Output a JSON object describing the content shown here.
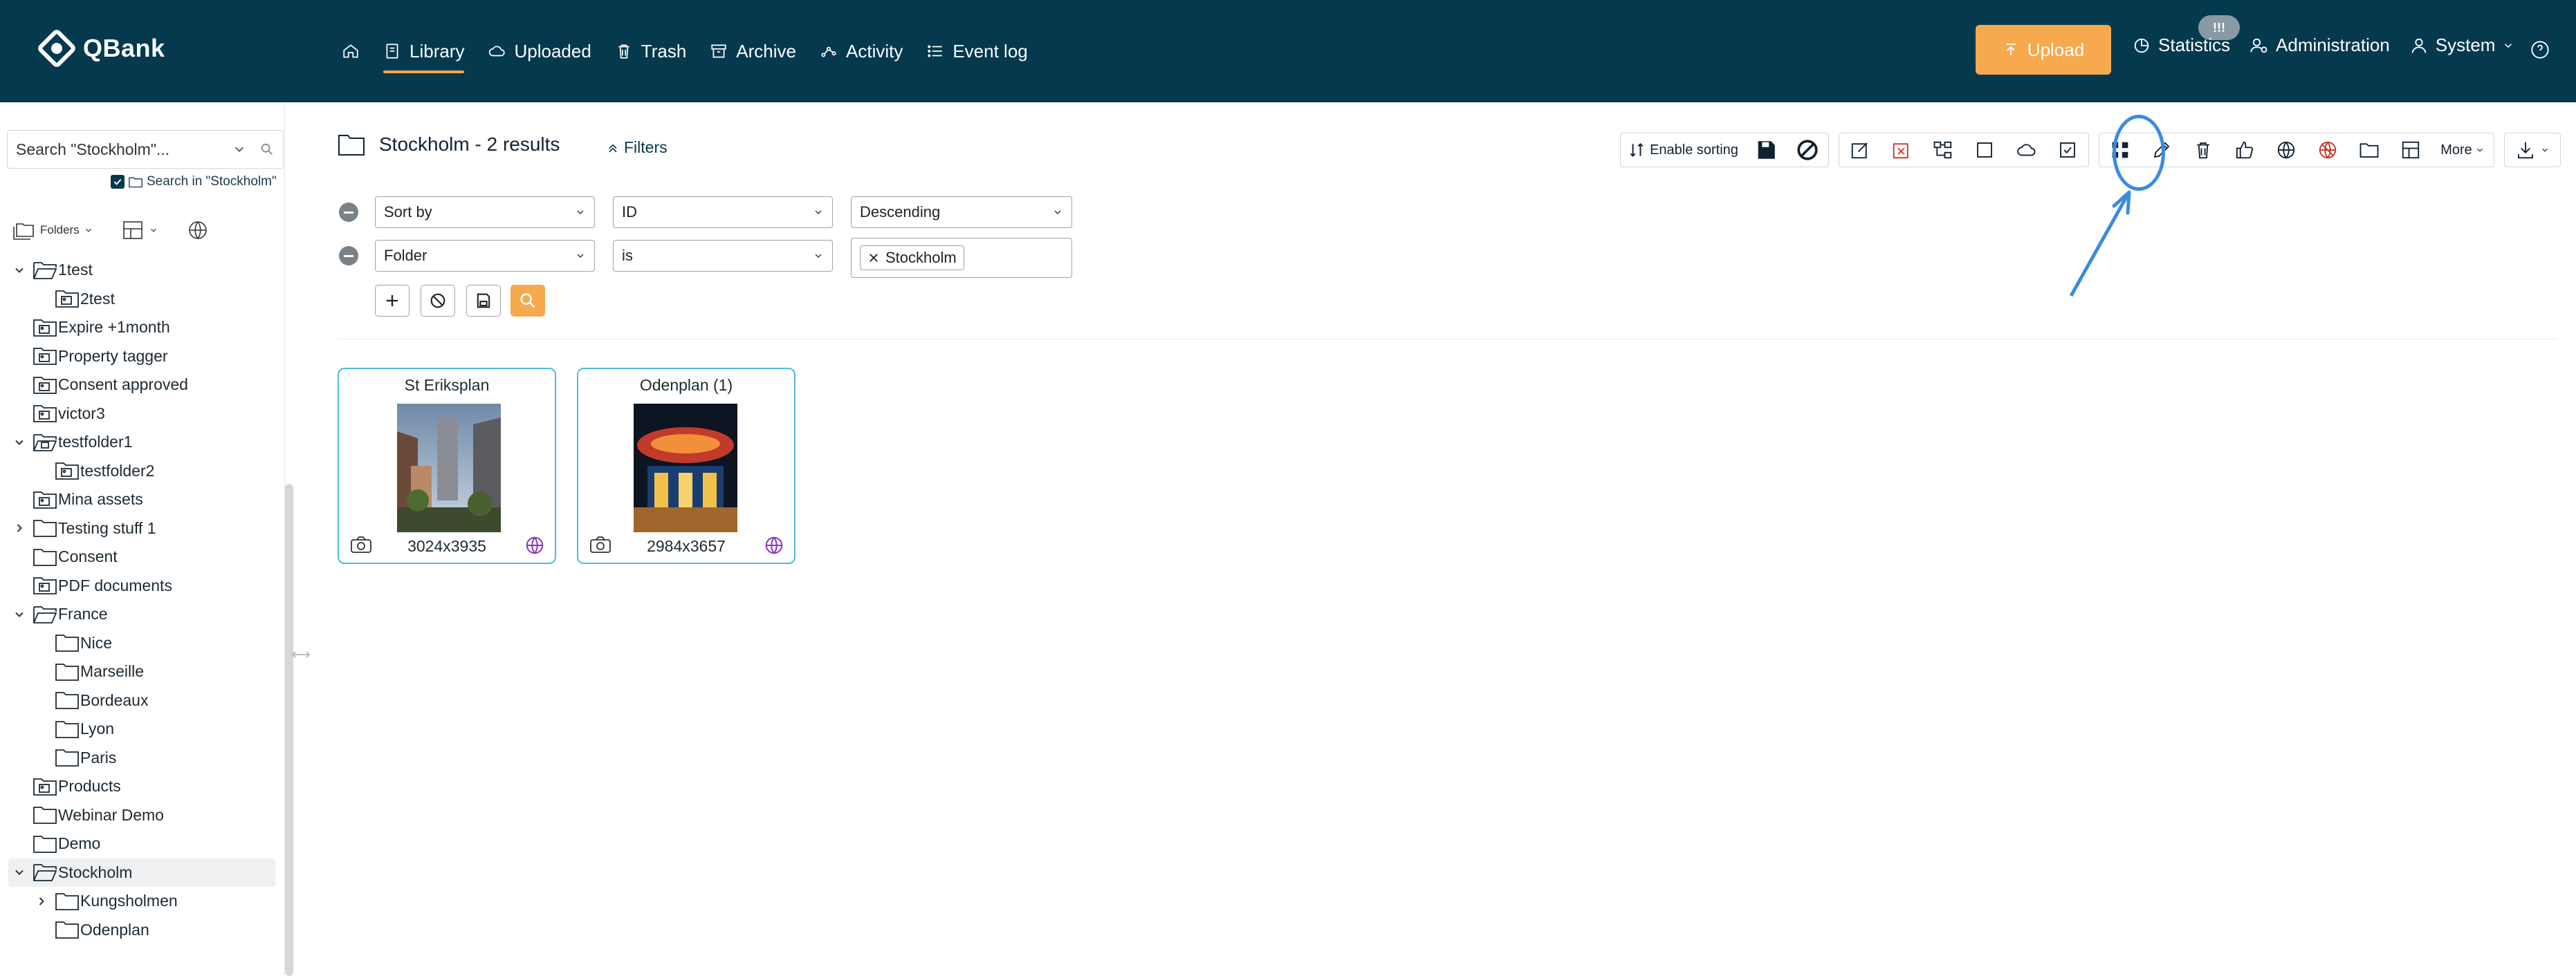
{
  "app": {
    "name": "QBank"
  },
  "nav": {
    "home_label": "",
    "items": [
      {
        "label": "Library"
      },
      {
        "label": "Uploaded"
      },
      {
        "label": "Trash"
      },
      {
        "label": "Archive"
      },
      {
        "label": "Activity"
      },
      {
        "label": "Event log"
      }
    ]
  },
  "topright": {
    "upload_label": "Upload",
    "statistics_label": "Statistics",
    "administration_label": "Administration",
    "system_label": "System",
    "badge": "!!!"
  },
  "sidebar": {
    "search_value": "Search \"Stockholm\"...",
    "search_in_label": "Search in \"Stockholm\"",
    "folders_label": "Folders",
    "tree": [
      {
        "label": "1test"
      },
      {
        "label": "2test"
      },
      {
        "label": "Expire +1month"
      },
      {
        "label": "Property tagger"
      },
      {
        "label": "Consent approved"
      },
      {
        "label": "victor3"
      },
      {
        "label": "testfolder1"
      },
      {
        "label": "testfolder2"
      },
      {
        "label": "Mina assets"
      },
      {
        "label": "Testing stuff 1"
      },
      {
        "label": "Consent"
      },
      {
        "label": "PDF documents"
      },
      {
        "label": "France"
      },
      {
        "label": "Nice"
      },
      {
        "label": "Marseille"
      },
      {
        "label": "Bordeaux"
      },
      {
        "label": "Lyon"
      },
      {
        "label": "Paris"
      },
      {
        "label": "Products"
      },
      {
        "label": "Webinar Demo"
      },
      {
        "label": "Demo"
      },
      {
        "label": "Stockholm"
      },
      {
        "label": "Kungsholmen"
      },
      {
        "label": "Odenplan"
      }
    ]
  },
  "main": {
    "title": "Stockholm - 2 results",
    "filters_label": "Filters",
    "enable_sorting_label": "Enable sorting",
    "more_label": "More",
    "filter_rows": [
      {
        "field": "Sort by",
        "op": "ID",
        "value": "Descending"
      },
      {
        "field": "Folder",
        "op": "is",
        "tag": "Stockholm"
      }
    ]
  },
  "results": [
    {
      "title": "St Eriksplan",
      "dimensions": "3024x3935"
    },
    {
      "title": "Odenplan (1)",
      "dimensions": "2984x3657"
    }
  ],
  "colors": {
    "topbar": "#04394e",
    "accent": "#f7a94d",
    "card_border": "#4dbbe0",
    "highlight_ring": "#3a8be0"
  }
}
